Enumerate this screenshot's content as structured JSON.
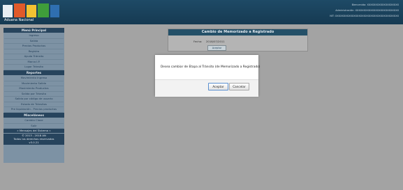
{
  "header": {
    "logo_text": "Aduana Nacional",
    "line1": "Bienvenido: XXXXXXXXXXXXXXXXXXX",
    "line2": "Administración: XXXXXXXXXXXXXXXXXXXXXXXXXX",
    "line3": "NIT: XXXXXXXXXXXXXXXXXXXXXXXXXXXXXXXXXXXXXX"
  },
  "sidebar": {
    "menu_title": "Menú Principal",
    "menu_items": [
      "Ingreso",
      "Salida",
      "Precios Productos",
      "Registro",
      "Ayuda Tránsito",
      "Marca I.P.",
      "Lugar Tránsito"
    ],
    "reports_title": "Reportes",
    "report_items": [
      "Movimiento Ingreso",
      "Movimiento Salida",
      "Movimiento Productos",
      "Salida por Tránsito",
      "Salida por código de usuario",
      "Estado de Tránsitos",
      "Pre liquidación - Precios productos"
    ],
    "misc_title": "Misceláneos",
    "misc_items": [
      "Cambio Clave",
      "Salir"
    ],
    "messages_label": "» Mensajes del Sistema «",
    "copyright": "© 2013 - 2018 AN",
    "rights": "Todos los derechos reservados",
    "version": "v3.0.21"
  },
  "panel": {
    "title": "Cambio de Memorizado a Registrado",
    "fecha_label": "Fecha:",
    "fecha_value": "2018/07/2011",
    "accept_label": "Aceptar"
  },
  "dialog": {
    "message": "Desea cambiar de Etapa al Tránsito (de Memorizado a Registrado)",
    "accept_label": "Aceptar",
    "cancel_label": "Cancelar"
  }
}
